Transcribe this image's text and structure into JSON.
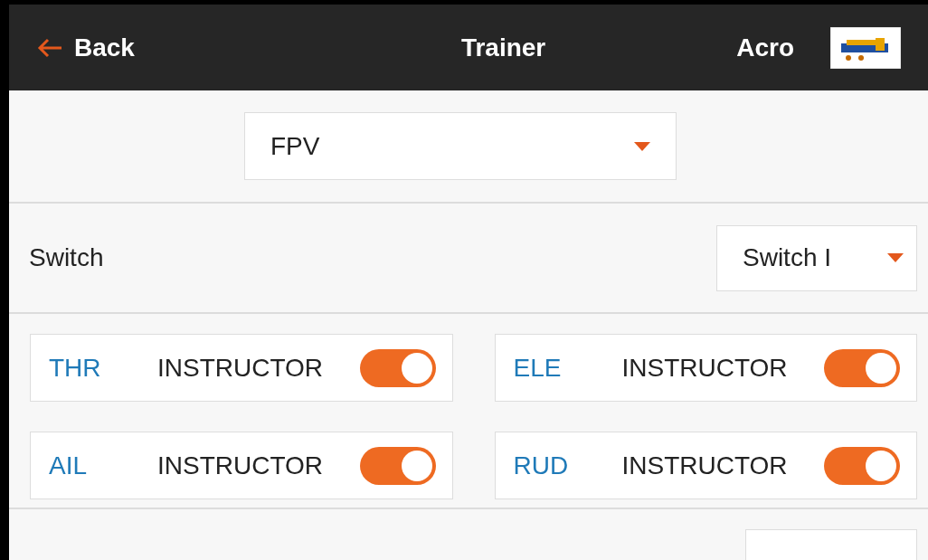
{
  "header": {
    "back": "Back",
    "title": "Trainer",
    "model_name": "Acro"
  },
  "mode_select": {
    "value": "FPV"
  },
  "switch_row": {
    "label": "Switch",
    "value": "Switch I"
  },
  "channels": [
    {
      "name": "THR",
      "role": "INSTRUCTOR",
      "on": true
    },
    {
      "name": "ELE",
      "role": "INSTRUCTOR",
      "on": true
    },
    {
      "name": "AIL",
      "role": "INSTRUCTOR",
      "on": true
    },
    {
      "name": "RUD",
      "role": "INSTRUCTOR",
      "on": true
    }
  ]
}
